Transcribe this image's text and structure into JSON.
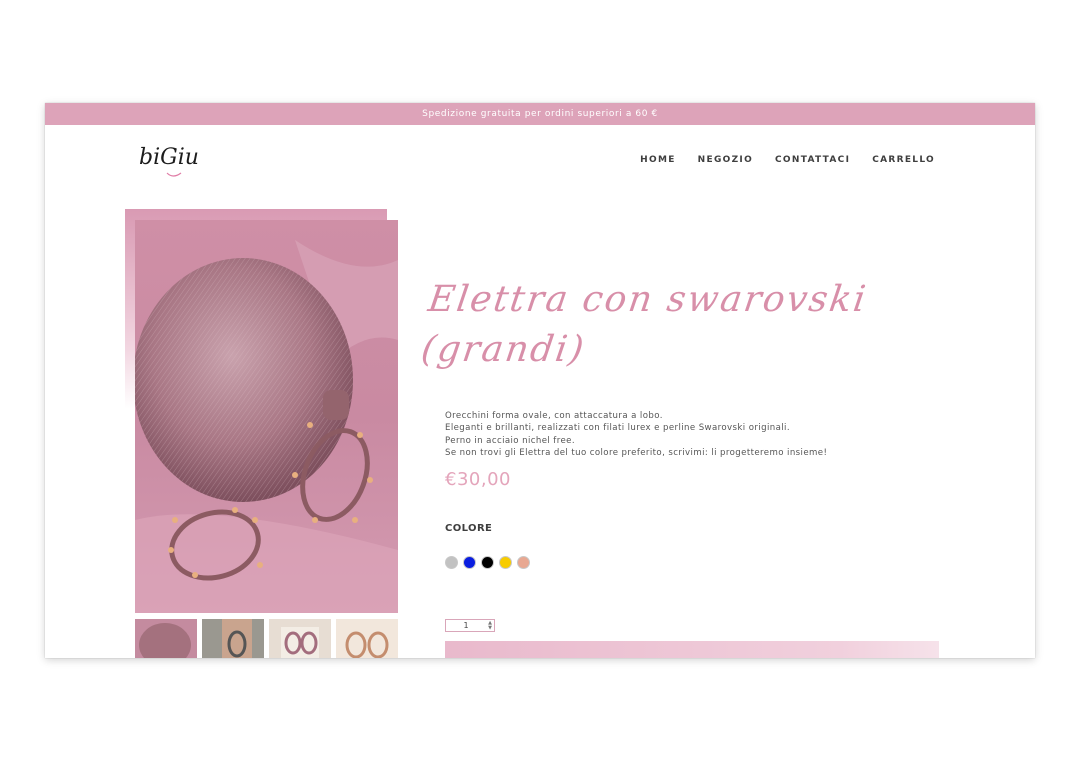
{
  "shipping_bar": {
    "text": "Spedizione gratuita per ordini superiori a 60 €"
  },
  "brand": {
    "logo_text": "biGiu"
  },
  "nav": {
    "items": [
      {
        "label": "HOME"
      },
      {
        "label": "NEGOZIO"
      },
      {
        "label": "CONTATTACI"
      },
      {
        "label": "CARRELLO"
      }
    ]
  },
  "product": {
    "title": "Elettra con swarovski (grandi)",
    "description": [
      "Orecchini forma ovale, con attaccatura a lobo.",
      "Eleganti e brillanti, realizzati con filati lurex e perline Swarovski originali.",
      "Perno in acciaio nichel free.",
      "Se non trovi gli Elettra del tuo colore preferito, scrivimi: li progetteremo insieme!"
    ],
    "price": "€30,00",
    "color_label": "COLORE",
    "colors": [
      "#c2c2c2",
      "#0a1ee0",
      "#000000",
      "#f7cc00",
      "#e8a892"
    ],
    "quantity": "1"
  },
  "icons": {
    "zoom": "magnifier-icon",
    "qty_stepper": "up-down-arrows-icon"
  },
  "theme": {
    "accent_pink": "#dda3b9",
    "title_pink": "#d88fa9",
    "price_pink": "#e4a5bb"
  }
}
